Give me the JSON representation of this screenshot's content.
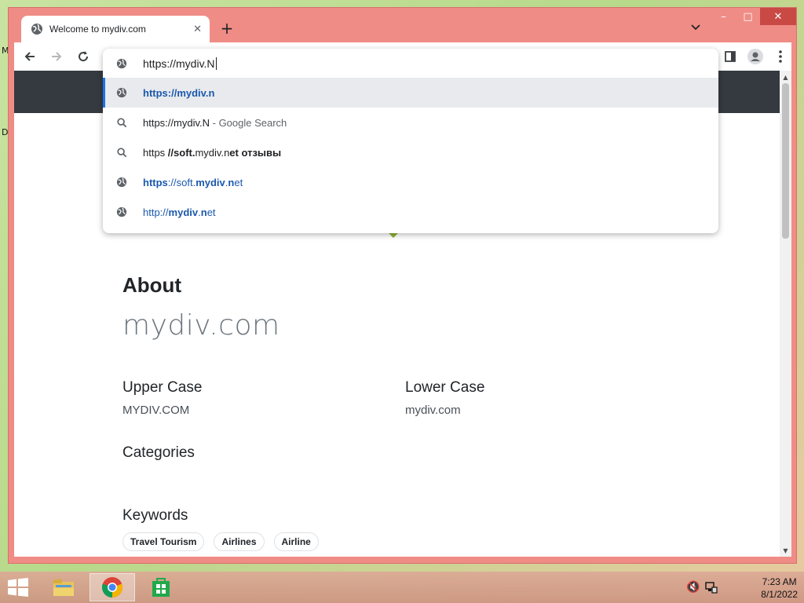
{
  "desktop": {
    "edge_glyphs": [
      "M",
      "D"
    ]
  },
  "browser": {
    "tab_title": "Welcome to mydiv.com",
    "window_controls": {
      "minimize": "–",
      "maximize": "□",
      "close": "✕"
    },
    "new_tab_label": "+",
    "tab_search_label": "⌄",
    "omnibox_value": "https://mydiv.N",
    "suggestions": [
      {
        "type": "url",
        "icon": "globe-icon",
        "parts": [
          {
            "t": "https://mydiv.n",
            "s": "url b"
          }
        ],
        "selected": true
      },
      {
        "type": "search",
        "icon": "search-icon",
        "parts": [
          {
            "t": "https://mydiv.N",
            "s": ""
          },
          {
            "t": " - Google Search",
            "s": "muted"
          }
        ]
      },
      {
        "type": "search",
        "icon": "search-icon",
        "parts": [
          {
            "t": "https ",
            "s": ""
          },
          {
            "t": "//soft.",
            "s": "b"
          },
          {
            "t": "mydiv.n",
            "s": ""
          },
          {
            "t": "et отзывы",
            "s": "b"
          }
        ]
      },
      {
        "type": "url",
        "icon": "globe-icon",
        "parts": [
          {
            "t": "https",
            "s": "url b"
          },
          {
            "t": "://soft.",
            "s": "url"
          },
          {
            "t": "mydiv",
            "s": "url b"
          },
          {
            "t": ".",
            "s": "url"
          },
          {
            "t": "n",
            "s": "url b"
          },
          {
            "t": "et",
            "s": "url"
          }
        ]
      },
      {
        "type": "url",
        "icon": "globe-icon",
        "parts": [
          {
            "t": "http://",
            "s": "url"
          },
          {
            "t": "mydiv",
            "s": "url b"
          },
          {
            "t": ".",
            "s": "url"
          },
          {
            "t": "n",
            "s": "url b"
          },
          {
            "t": "et",
            "s": "url"
          }
        ]
      }
    ]
  },
  "page": {
    "about_title": "About",
    "domain": "mydiv.com",
    "upper_case_label": "Upper Case",
    "upper_case_value": "MYDIV.COM",
    "lower_case_label": "Lower Case",
    "lower_case_value": "mydiv.com",
    "categories_label": "Categories",
    "keywords_label": "Keywords",
    "keywords": [
      "Travel Tourism",
      "Airlines",
      "Airline"
    ]
  },
  "taskbar": {
    "apps": [
      "file-explorer",
      "chrome",
      "store"
    ],
    "active_app": "chrome",
    "time": "7:23 AM",
    "date": "8/1/2022"
  },
  "colors": {
    "window_frame": "#f08c86",
    "site_header": "#343a40",
    "link_blue": "#1a58ad",
    "accent_green": "#8ab434"
  }
}
